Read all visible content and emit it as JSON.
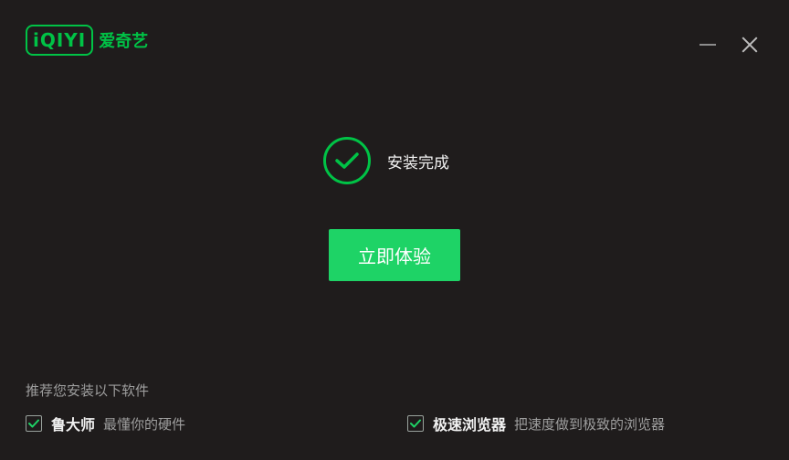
{
  "brand": {
    "logo_mark": "iQIYI",
    "logo_text": "爱奇艺",
    "color": "#00c346"
  },
  "window_controls": {
    "minimize_icon": "minimize-icon",
    "close_icon": "close-icon"
  },
  "status": {
    "icon": "check-circle-icon",
    "text": "安装完成"
  },
  "cta": {
    "label": "立即体验",
    "color": "#1ed366"
  },
  "recommend": {
    "title": "推荐您安装以下软件",
    "items": [
      {
        "name": "鲁大师",
        "desc": "最懂你的硬件",
        "checked": true
      },
      {
        "name": "极速浏览器",
        "desc": "把速度做到极致的浏览器",
        "checked": true
      }
    ]
  }
}
